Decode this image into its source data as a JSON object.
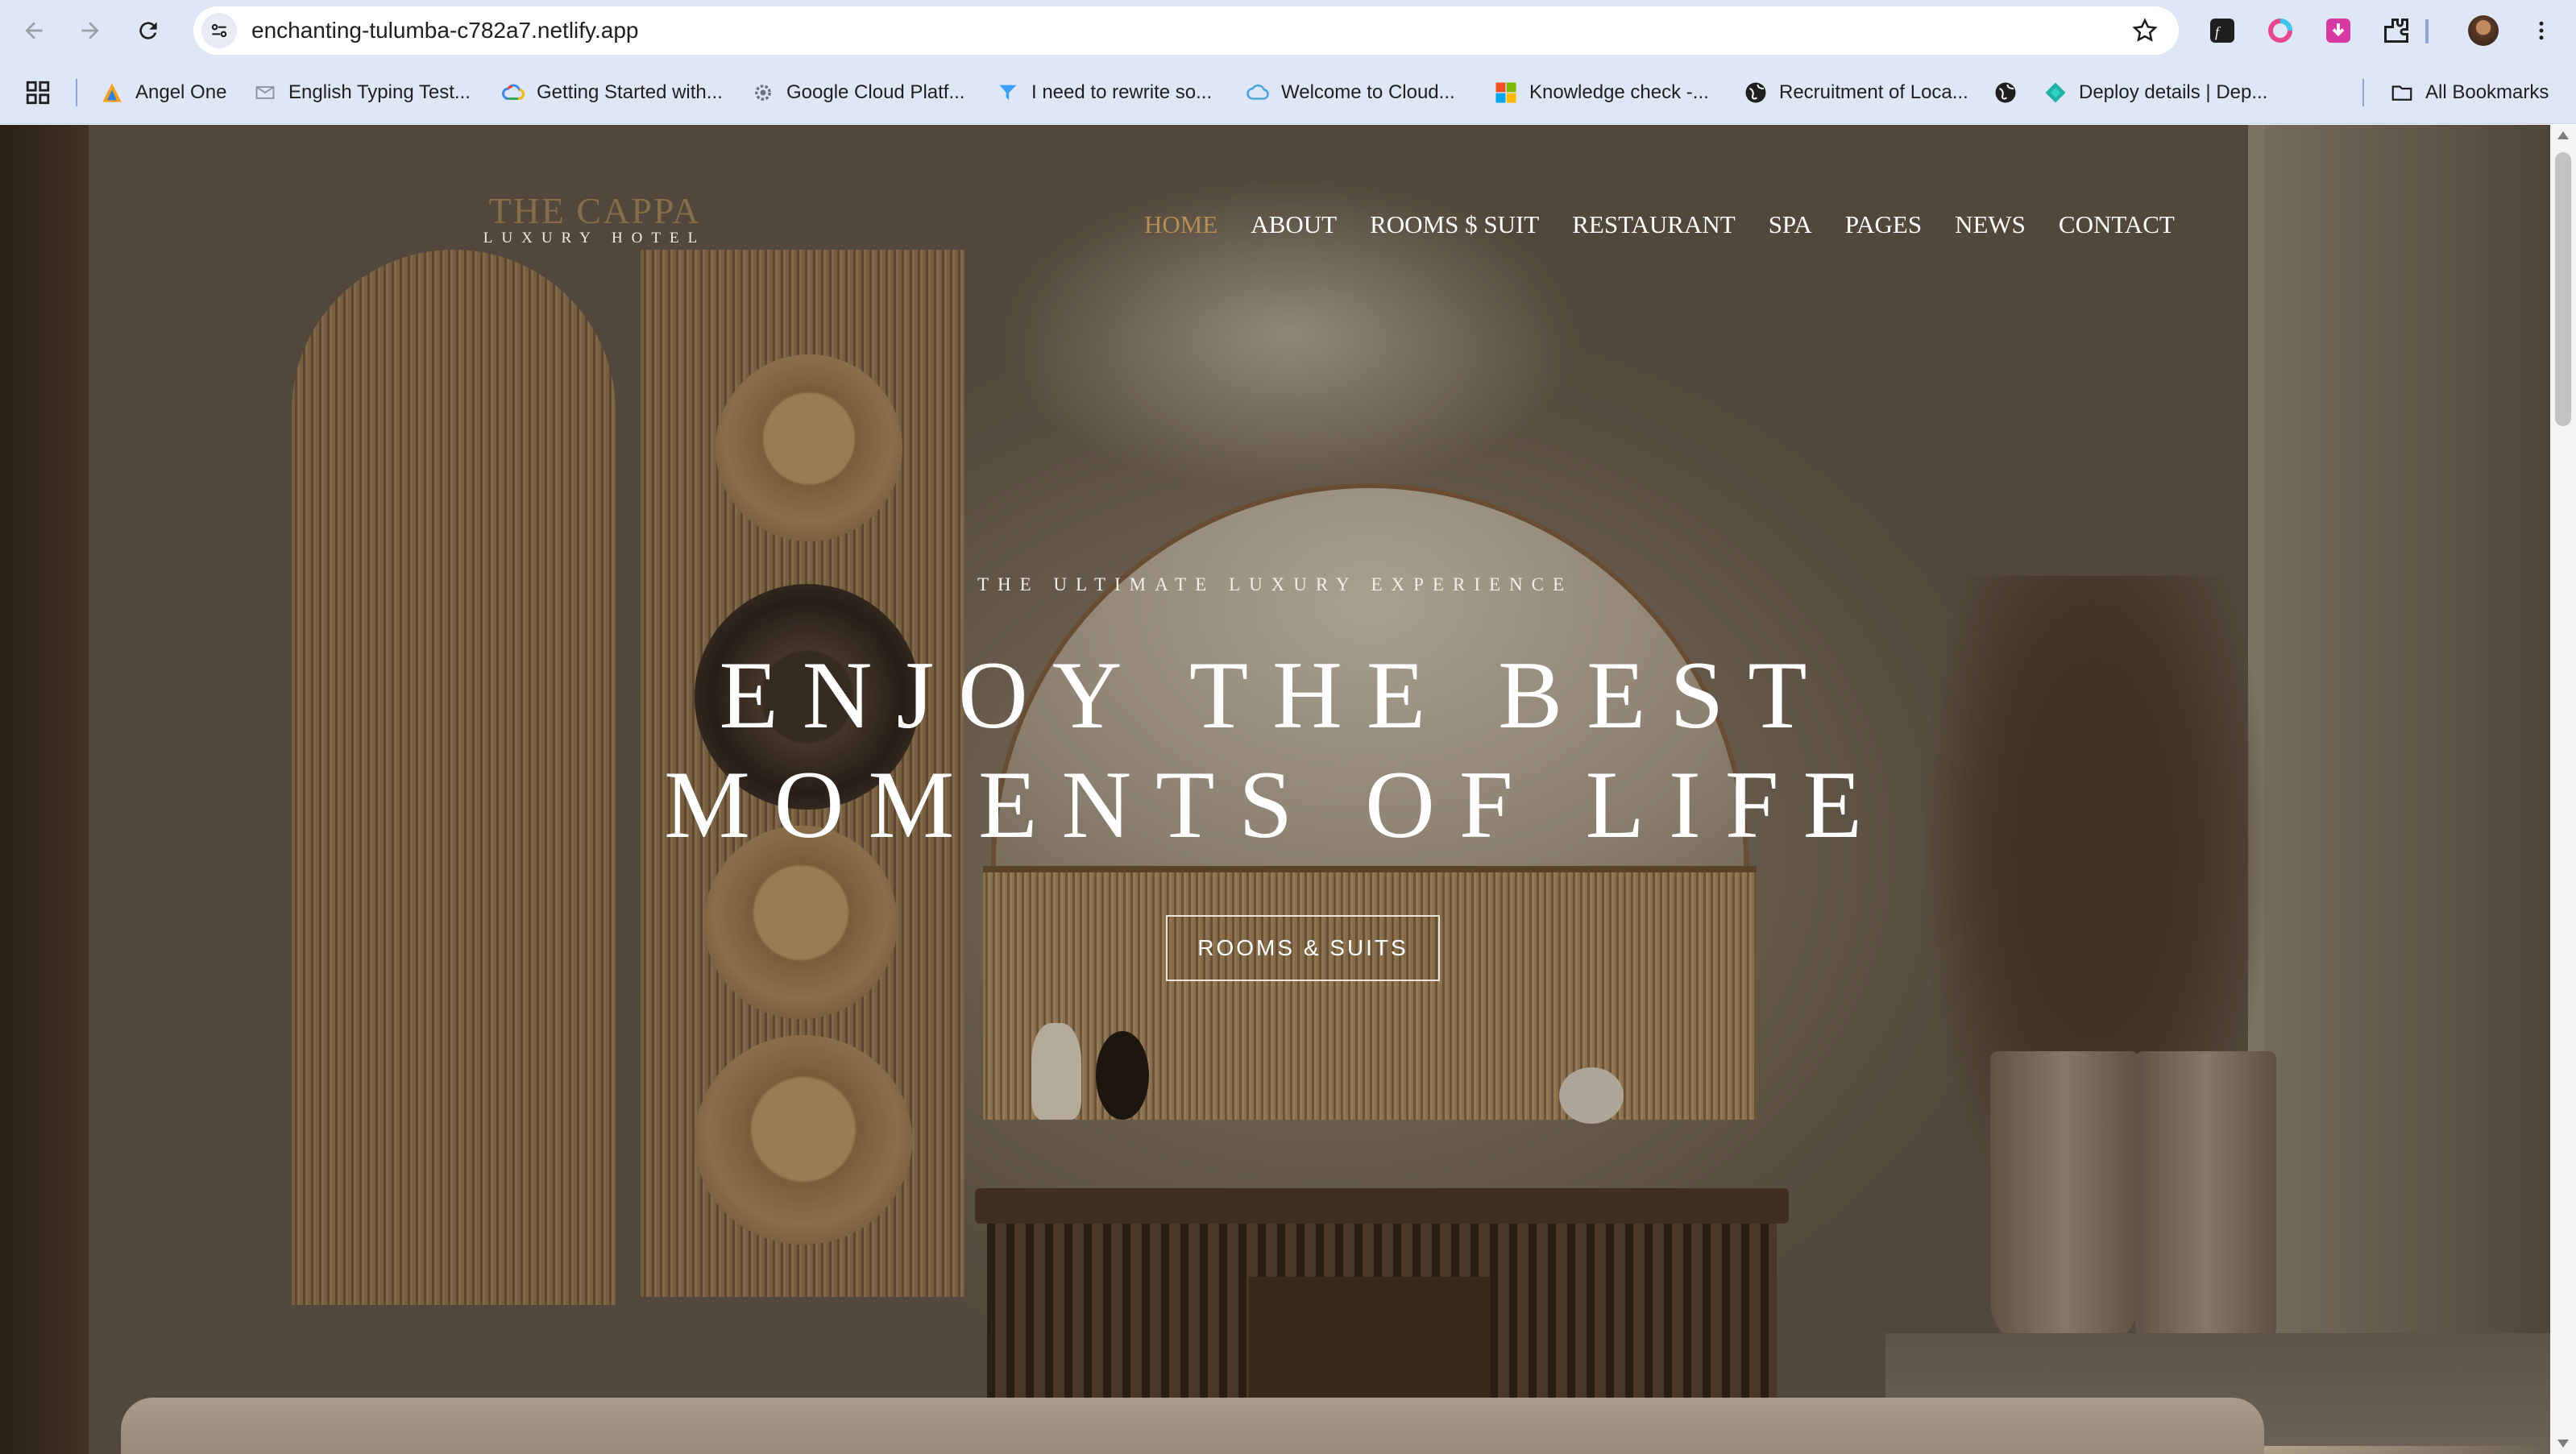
{
  "browser": {
    "url": "enchanting-tulumba-c782a7.netlify.app",
    "icons": [
      "back-icon",
      "forward-icon",
      "reload-icon",
      "site-info-icon",
      "star-icon",
      "extension-icons",
      "profile-avatar",
      "menu-icon"
    ],
    "bookmarks": [
      {
        "label": "Angel One",
        "icon": "angel-one-icon"
      },
      {
        "label": "English Typing Test...",
        "icon": "typing-icon"
      },
      {
        "label": "Getting Started with...",
        "icon": "google-cloud-icon"
      },
      {
        "label": "Google Cloud Platf...",
        "icon": "gear-icon"
      },
      {
        "label": "I need to rewrite so...",
        "icon": "quillbot-icon"
      },
      {
        "label": "Welcome to Cloud...",
        "icon": "cloud-icon"
      },
      {
        "label": "Knowledge check -...",
        "icon": "microsoft-icon"
      },
      {
        "label": "Recruitment of Loca...",
        "icon": "globe-icon"
      },
      {
        "label": "",
        "icon": "globe-icon"
      },
      {
        "label": "Deploy details | Dep...",
        "icon": "netlify-icon"
      }
    ],
    "all_bookmarks_label": "All Bookmarks"
  },
  "site": {
    "logo_name": "THE CAPPA",
    "logo_sub": "LUXURY HOTEL",
    "nav": [
      "HOME",
      "ABOUT",
      "ROOMS $ SUIT",
      "RESTAURANT",
      "SPA",
      "PAGES",
      "NEWS",
      "CONTACT"
    ],
    "active_nav": "HOME"
  },
  "hero": {
    "kicker": "THE ULTIMATE LUXURY EXPERIENCE",
    "title_line1": "ENJOY THE BEST",
    "title_line2": "MOMENTS OF LIFE",
    "button": "ROOMS & SUITS"
  },
  "colors": {
    "accent": "#b58d55",
    "chrome": "#dfe7f7"
  }
}
